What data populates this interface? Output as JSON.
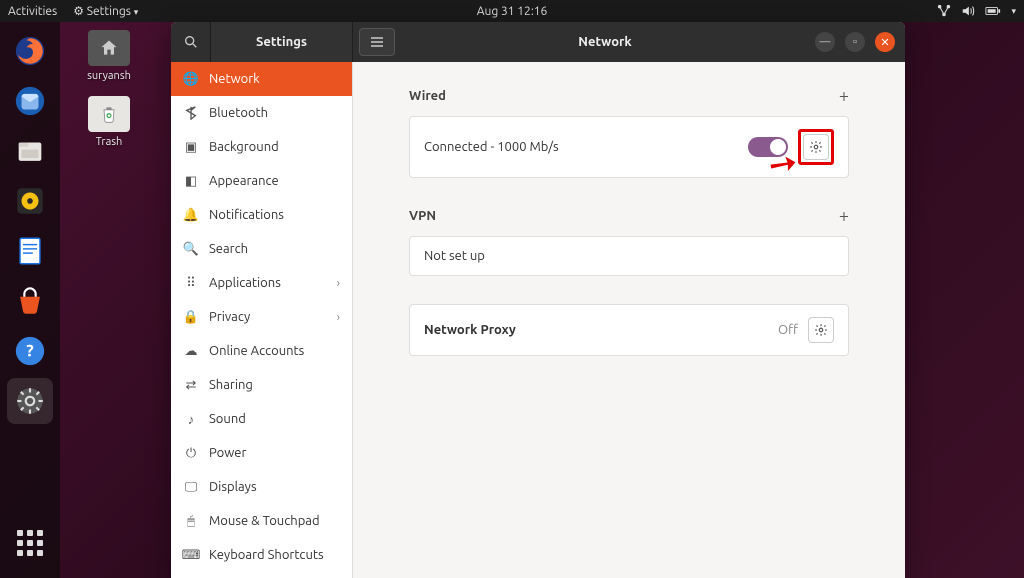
{
  "topbar": {
    "activities": "Activities",
    "app_menu": "Settings",
    "datetime": "Aug 31  12:16"
  },
  "desktop": {
    "home_label": "suryansh",
    "trash_label": "Trash"
  },
  "window": {
    "sidebar_title": "Settings",
    "main_title": "Network"
  },
  "sidebar": {
    "items": [
      {
        "label": "Network",
        "icon": "globe"
      },
      {
        "label": "Bluetooth",
        "icon": "bluetooth"
      },
      {
        "label": "Background",
        "icon": "background"
      },
      {
        "label": "Appearance",
        "icon": "appearance"
      },
      {
        "label": "Notifications",
        "icon": "bell"
      },
      {
        "label": "Search",
        "icon": "search"
      },
      {
        "label": "Applications",
        "icon": "grid",
        "chevron": true
      },
      {
        "label": "Privacy",
        "icon": "lock",
        "chevron": true
      },
      {
        "label": "Online Accounts",
        "icon": "cloud"
      },
      {
        "label": "Sharing",
        "icon": "share"
      },
      {
        "label": "Sound",
        "icon": "music"
      },
      {
        "label": "Power",
        "icon": "power"
      },
      {
        "label": "Displays",
        "icon": "display"
      },
      {
        "label": "Mouse & Touchpad",
        "icon": "mouse"
      },
      {
        "label": "Keyboard Shortcuts",
        "icon": "keyboard"
      }
    ]
  },
  "network": {
    "wired_header": "Wired",
    "wired_status": "Connected - 1000 Mb/s",
    "vpn_header": "VPN",
    "vpn_status": "Not set up",
    "proxy_label": "Network Proxy",
    "proxy_state": "Off"
  }
}
